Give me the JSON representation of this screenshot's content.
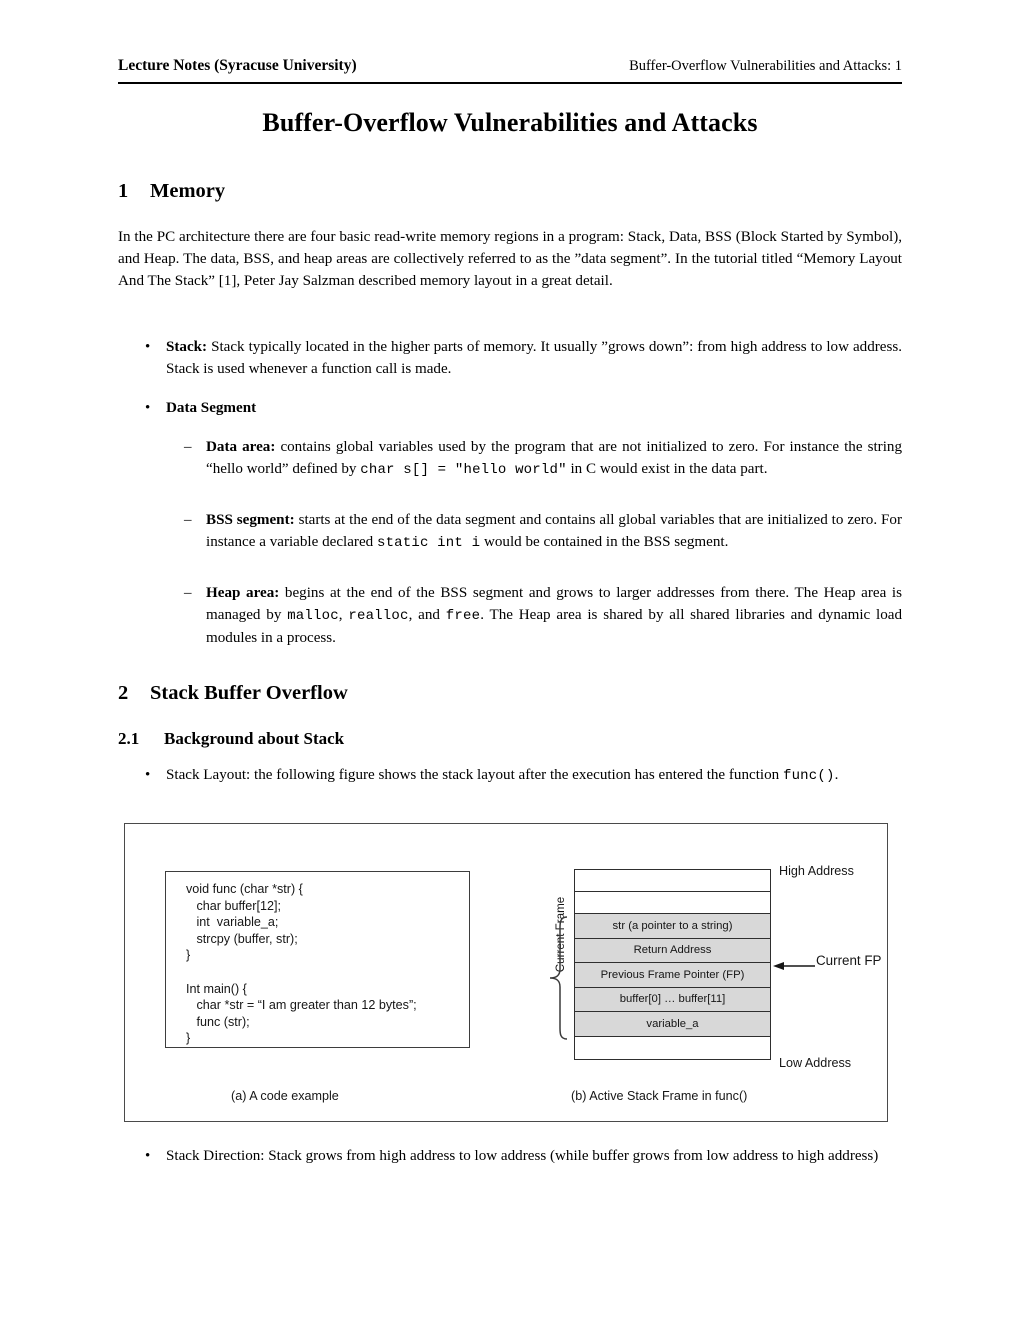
{
  "header": {
    "left": "Lecture Notes (Syracuse University)",
    "right": "Buffer-Overflow Vulnerabilities and Attacks: 1"
  },
  "title": "Buffer-Overflow Vulnerabilities and Attacks",
  "sections": {
    "s1": {
      "number": "1",
      "label": "Memory"
    },
    "s2": {
      "number": "2",
      "label": "Stack Buffer Overflow"
    },
    "s21": {
      "number": "2.1",
      "label": "Background about Stack"
    }
  },
  "intro_paragraph": "In the PC architecture there are four basic read-write memory regions in a program: Stack, Data, BSS (Block Started by Symbol), and Heap. The data, BSS, and heap areas are collectively referred to as the ”data segment”. In the tutorial titled “Memory Layout And The Stack” [1], Peter Jay Salzman described memory layout in a great detail.",
  "bullets": {
    "stack": {
      "lead": "Stack:",
      "text": " Stack typically located in the higher parts of memory. It usually ”grows down”: from high address to low address. Stack is used whenever a function call is made."
    },
    "data_segment": {
      "lead": "Data Segment"
    },
    "data_area": {
      "lead": "Data area:",
      "text_before": " contains global variables used by the program that are not initialized to zero. For instance the string “hello world” defined by ",
      "code1": "char s[] = \"hello world\"",
      "text_after": " in C would exist in the data part."
    },
    "bss_segment": {
      "lead": "BSS segment:",
      "text_before": " starts at the end of the data segment and contains all global variables that are initialized to zero. For instance a variable declared ",
      "code1": "static int i",
      "text_after": " would be contained in the BSS segment."
    },
    "heap_area": {
      "lead": "Heap area:",
      "text_before": " begins at the end of the BSS segment and grows to larger addresses from there. The Heap area is managed by ",
      "code1": "malloc",
      "sep1": ", ",
      "code2": "realloc",
      "sep2": ", and ",
      "code3": "free",
      "text_after": ". The Heap area is shared by all shared libraries and dynamic load modules in a process."
    },
    "stack_layout": {
      "text_before": "Stack Layout: the following figure shows the stack layout after the execution has entered the function ",
      "code1": "func()",
      "text_after": "."
    },
    "stack_direction": {
      "text": "Stack Direction: Stack grows from high address to low address (while buffer grows from low address to high address)"
    }
  },
  "figure": {
    "code_listing": "void func (char *str) {\n   char buffer[12];\n   int  variable_a;\n   strcpy (buffer, str);\n}\n\nInt main() {\n   char *str = “I am greater than 12 bytes”;\n   func (str);\n}",
    "caption_a": "(a) A code example",
    "caption_b": "(b) Active Stack Frame in func()",
    "stack_rows": [
      {
        "label": "",
        "shaded": false
      },
      {
        "label": "",
        "shaded": false
      },
      {
        "label": "str (a pointer to a string)",
        "shaded": true
      },
      {
        "label": "Return Address",
        "shaded": true
      },
      {
        "label": "Previous Frame Pointer (FP)",
        "shaded": true
      },
      {
        "label": "buffer[0] … buffer[11]",
        "shaded": true
      },
      {
        "label": "variable_a",
        "shaded": true
      },
      {
        "label": "",
        "shaded": false
      }
    ],
    "high_address_label": "High Address",
    "low_address_label": "Low Address",
    "current_fp_label": "Current FP",
    "current_frame_label": "Current Frame",
    "shade_color": "#d8d8d8",
    "line_color": "#2e2e2e"
  }
}
